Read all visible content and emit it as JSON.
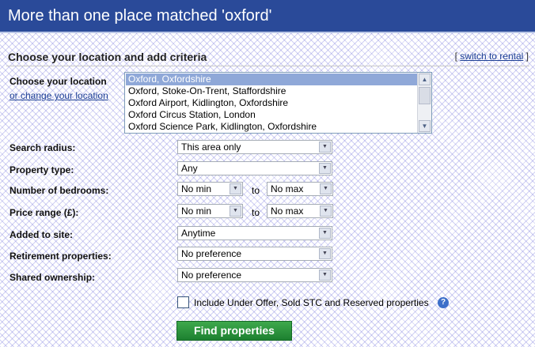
{
  "header": {
    "title": "More than one place matched 'oxford'"
  },
  "section": {
    "title": "Choose your location and add criteria",
    "switch_prefix": "[ ",
    "switch_link": "switch to rental",
    "switch_suffix": " ]"
  },
  "location": {
    "label": "Choose your location",
    "change_link": "or change your location",
    "options": [
      "Oxford, Oxfordshire",
      "Oxford, Stoke-On-Trent, Staffordshire",
      "Oxford Airport, Kidlington, Oxfordshire",
      "Oxford Circus Station, London",
      "Oxford Science Park, Kidlington, Oxfordshire"
    ],
    "selected_index": 0
  },
  "criteria": {
    "radius": {
      "label": "Search radius:",
      "value": "This area only"
    },
    "property_type": {
      "label": "Property type:",
      "value": "Any"
    },
    "bedrooms": {
      "label": "Number of bedrooms:",
      "min": "No min",
      "to": "to",
      "max": "No max"
    },
    "price": {
      "label": "Price range (£):",
      "min": "No min",
      "to": "to",
      "max": "No max"
    },
    "added": {
      "label": "Added to site:",
      "value": "Anytime"
    },
    "retirement": {
      "label": "Retirement properties:",
      "value": "No preference"
    },
    "shared": {
      "label": "Shared ownership:",
      "value": "No preference"
    }
  },
  "include_checkbox": {
    "label": "Include Under Offer, Sold STC and Reserved properties",
    "checked": false
  },
  "help_icon": {
    "glyph": "?"
  },
  "find_button": {
    "label": "Find properties"
  },
  "colors": {
    "header_bg": "#2a4a99",
    "button_green": "#1d8030",
    "link": "#1c3f94"
  }
}
